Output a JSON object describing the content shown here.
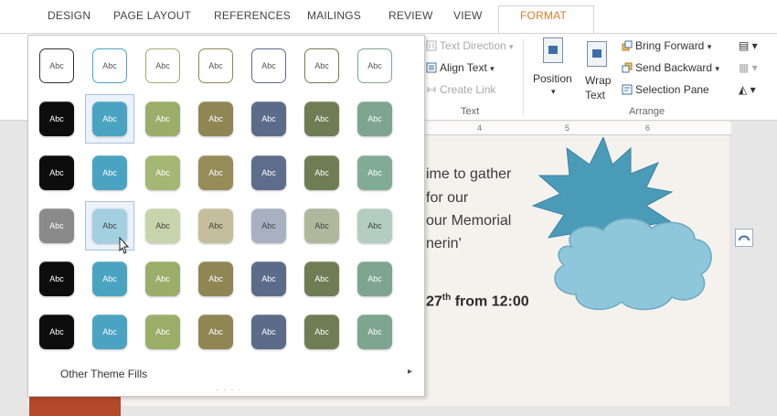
{
  "tabs": [
    "DESIGN",
    "PAGE LAYOUT",
    "REFERENCES",
    "MAILINGS",
    "REVIEW",
    "VIEW",
    "FORMAT"
  ],
  "ribbon": {
    "text_direction": "Text Direction",
    "align_text": "Align Text",
    "create_link": "Create Link",
    "text_group": "Text",
    "position": "Position",
    "wrap_text_1": "Wrap",
    "wrap_text_2": "Text",
    "bring_forward": "Bring Forward",
    "send_backward": "Send Backward",
    "selection_pane": "Selection Pane",
    "arrange_group": "Arrange"
  },
  "gallery": {
    "swatch_label": "Abc",
    "rows": [
      {
        "style": "outline",
        "colors": [
          "#333333",
          "#4aa3c1",
          "#9aae6a",
          "#8f8654",
          "#5c6b8a",
          "#6f7d55",
          "#7da58f"
        ]
      },
      {
        "style": "solid",
        "colors": [
          "#0d0d0d",
          "#4aa3c1",
          "#9aae6a",
          "#8f8654",
          "#5c6b8a",
          "#6f7d55",
          "#7da58f"
        ]
      },
      {
        "style": "solid",
        "colors": [
          "#0d0d0d",
          "#4aa3c1",
          "#a4b774",
          "#958c5a",
          "#5f6d8c",
          "#6f7d55",
          "#82ab96"
        ]
      },
      {
        "style": "light",
        "colors": [
          "#8a8a8a",
          "#a3d0e0",
          "#c8d4ac",
          "#c4be9c",
          "#a9b0c2",
          "#b0b79c",
          "#b3cec0"
        ]
      },
      {
        "style": "solid",
        "colors": [
          "#0d0d0d",
          "#4aa3c1",
          "#9aae6a",
          "#8f8654",
          "#5c6b8a",
          "#6f7d55",
          "#7da58f"
        ]
      },
      {
        "style": "solid",
        "colors": [
          "#0d0d0d",
          "#4aa3c1",
          "#9aae6a",
          "#8f8654",
          "#5c6b8a",
          "#6f7d55",
          "#7da58f"
        ]
      }
    ],
    "footer": "Other Theme Fills"
  },
  "document": {
    "line1": "ime to gather",
    "line2": "for our",
    "line3": "our Memorial",
    "line4": "nerin'",
    "bold_prefix": "27",
    "bold_sup": "th",
    "bold_suffix": " from 12:00"
  },
  "ruler": [
    "4",
    "5",
    "6"
  ],
  "colors": {
    "accent": "#d67a2a",
    "star": "#4a9bb8",
    "cloud": "#8ec7dc"
  }
}
